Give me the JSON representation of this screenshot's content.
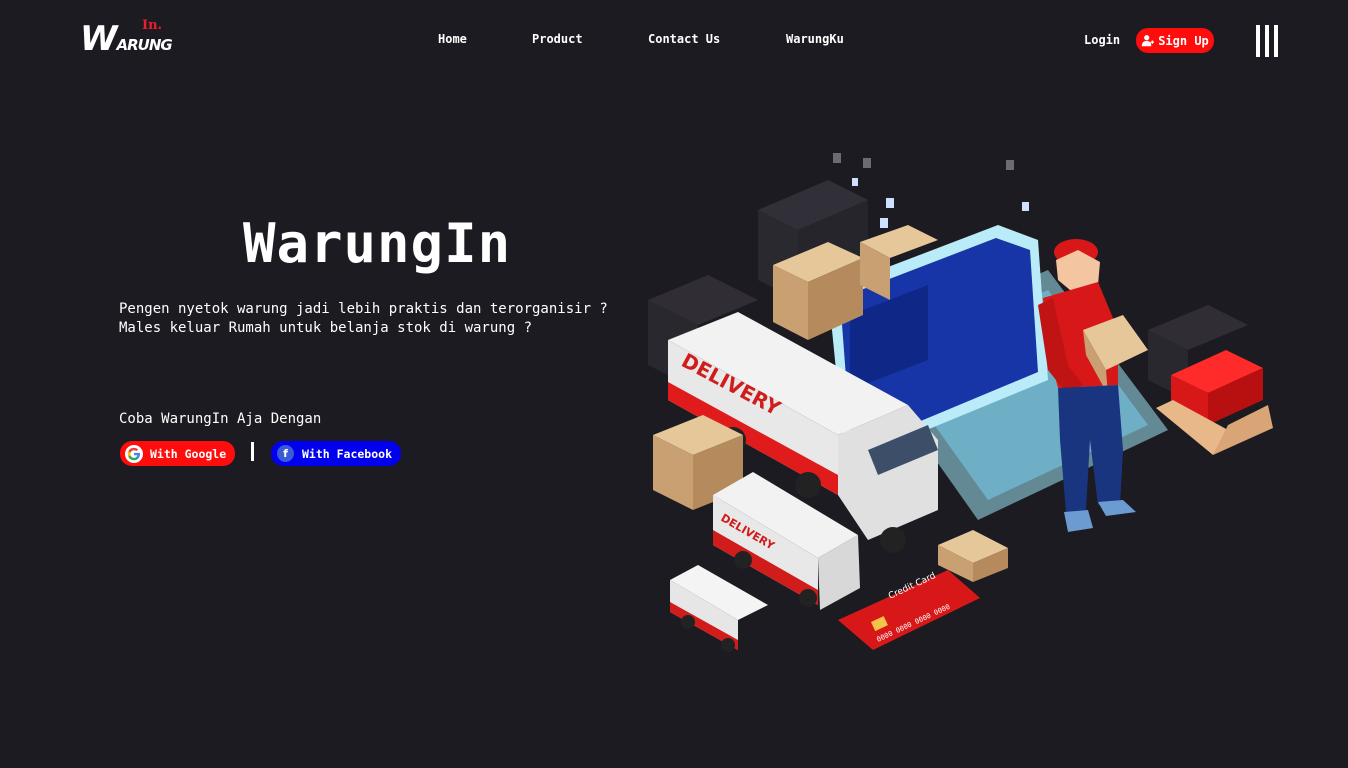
{
  "brand": {
    "logo_main_first": "W",
    "logo_main_rest": "ARUNG",
    "logo_sup": "In."
  },
  "nav": {
    "items": [
      {
        "label": "Home"
      },
      {
        "label": "Product"
      },
      {
        "label": "Contact Us"
      },
      {
        "label": "WarungKu"
      }
    ],
    "login_label": "Login",
    "signup_label": "Sign Up"
  },
  "hero": {
    "title": "WarungIn",
    "desc_line1": "Pengen nyetok warung jadi lebih praktis dan terorganisir ?",
    "desc_line2": "Males keluar Rumah untuk belanja stok di warung ?",
    "cta_text": "Coba WarungIn Aja Dengan",
    "google_label": "With Google",
    "facebook_label": "With Facebook"
  },
  "illustration": {
    "truck_text": "DELIVERY",
    "van_text": "DELIVERY",
    "card_text": "Credit Card",
    "card_number": "0000 0000 0000 0000"
  },
  "icons": {
    "signup": "user-icon",
    "menu": "menu-icon",
    "google": "google-icon",
    "facebook": "facebook-icon"
  },
  "colors": {
    "background": "#1c1b21",
    "accent_red": "#ff0c0c",
    "facebook_blue": "#0000ee",
    "text": "#ffffff"
  }
}
